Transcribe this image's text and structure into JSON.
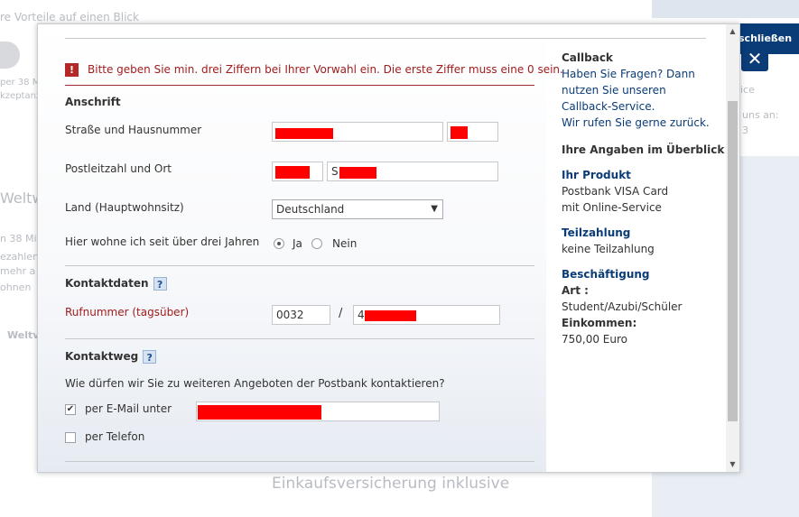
{
  "background": {
    "top_text": "re Vorteile auf einen Blick",
    "left_fragments": [
      "per 38 Mi",
      "kzeptanz",
      "Weltw",
      "n 38 Mi",
      "ezahlen",
      "mehr a",
      "ohnen",
      "Weltv"
    ],
    "right_fragments": [
      "ice",
      "uns an:",
      "3"
    ],
    "footer_text": "Einkaufsversicherung inklusive",
    "close_label": "schließen",
    "close_icon": "✕"
  },
  "error": {
    "icon": "!",
    "message": "Bitte geben Sie min. drei Ziffern bei Ihrer Vorwahl ein. Die erste Ziffer muss eine 0 sein."
  },
  "anschrift": {
    "title": "Anschrift",
    "street_label": "Straße und Hausnummer",
    "zip_city_label": "Postleitzahl und Ort",
    "city_prefix": "S",
    "country_label": "Land (Hauptwohnsitz)",
    "country_value": "Deutschland",
    "dropdown_arrow": "▼",
    "residence_label": "Hier wohne ich seit über drei Jahren",
    "residence_yes": "Ja",
    "residence_no": "Nein"
  },
  "kontaktdaten": {
    "title": "Kontaktdaten",
    "help": "?",
    "phone_label": "Rufnummer (tagsüber)",
    "area_code": "0032",
    "separator": "/",
    "phone_prefix": "4"
  },
  "kontaktweg": {
    "title": "Kontaktweg",
    "help": "?",
    "question": "Wie dürfen wir Sie zu weiteren Angeboten der Postbank kontaktieren?",
    "email_label": "per E-Mail unter",
    "email_checked": true,
    "check_mark": "✔",
    "phone_label": "per Telefon",
    "phone_checked": false
  },
  "sidebar": {
    "callback_title": "Callback",
    "callback_lines": [
      "Haben Sie Fragen? Dann",
      "nutzen Sie unseren",
      "Callback-Service.",
      "Wir rufen Sie gerne zurück."
    ],
    "overview_title": "Ihre Angaben im Überblick",
    "product_title": "Ihr Produkt",
    "product_lines": [
      "Postbank VISA Card",
      "mit Online-Service"
    ],
    "installment_title": "Teilzahlung",
    "installment_value": "keine Teilzahlung",
    "employment_title": "Beschäftigung",
    "type_label": "Art :",
    "type_value": "Student/Azubi/Schüler",
    "income_label": "Einkommen:",
    "income_value": "750,00 Euro"
  },
  "scrollbar": {
    "up": "▲",
    "down": "▼"
  },
  "colors": {
    "error": "#a11c1c",
    "brand": "#0a3c78",
    "redaction": "#ff0000"
  }
}
